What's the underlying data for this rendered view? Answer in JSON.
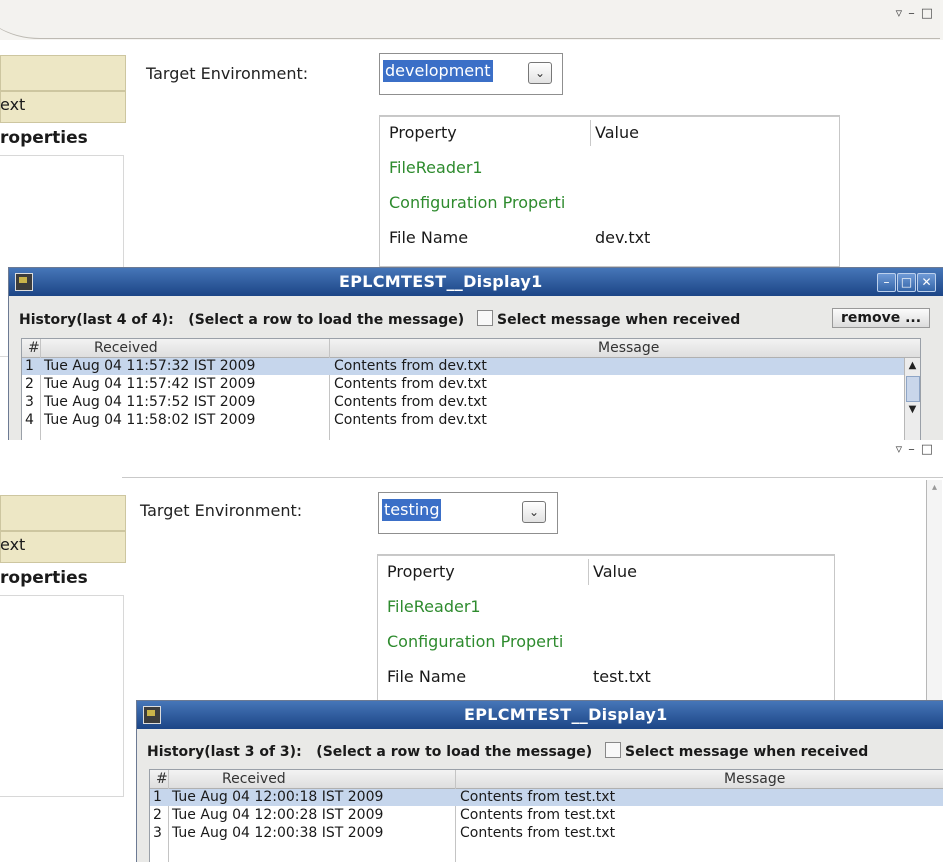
{
  "panels": [
    {
      "nav": {
        "item_text": "ext",
        "item_properties": "roperties"
      },
      "env_label": "Target Environment:",
      "env_value": "development",
      "prop_table": {
        "headers": [
          "Property",
          "Value"
        ],
        "rows": [
          {
            "property": "FileReader1",
            "value": ""
          },
          {
            "property": "Configuration Properti",
            "value": ""
          },
          {
            "property": "File Name",
            "value": "dev.txt"
          }
        ]
      },
      "window": {
        "title": "EPLCMTEST__Display1",
        "history_label": "History(last 4 of 4):",
        "hint": "(Select a row to load the message)",
        "checkbox_label": "Select message when received",
        "remove_label": "remove ...",
        "columns": [
          "#",
          "Received",
          "Message"
        ],
        "rows": [
          {
            "num": "1",
            "received": "Tue Aug 04 11:57:32 IST 2009",
            "message": "Contents from dev.txt",
            "selected": true
          },
          {
            "num": "2",
            "received": "Tue Aug 04 11:57:42 IST 2009",
            "message": "Contents from dev.txt",
            "selected": false
          },
          {
            "num": "3",
            "received": "Tue Aug 04 11:57:52 IST 2009",
            "message": "Contents from dev.txt",
            "selected": false
          },
          {
            "num": "4",
            "received": "Tue Aug 04 11:58:02 IST 2009",
            "message": "Contents from dev.txt",
            "selected": false
          }
        ]
      }
    },
    {
      "nav": {
        "item_text": "ext",
        "item_properties": "roperties"
      },
      "env_label": "Target Environment:",
      "env_value": "testing",
      "prop_table": {
        "headers": [
          "Property",
          "Value"
        ],
        "rows": [
          {
            "property": "FileReader1",
            "value": ""
          },
          {
            "property": "Configuration Properti",
            "value": ""
          },
          {
            "property": "File Name",
            "value": "test.txt"
          }
        ]
      },
      "window": {
        "title": "EPLCMTEST__Display1",
        "history_label": "History(last 3 of 3):",
        "hint": "(Select a row to load the message)",
        "checkbox_label": "Select message when received",
        "columns": [
          "#",
          "Received",
          "Message"
        ],
        "rows": [
          {
            "num": "1",
            "received": "Tue Aug 04 12:00:18 IST 2009",
            "message": "Contents from test.txt",
            "selected": true
          },
          {
            "num": "2",
            "received": "Tue Aug 04 12:00:28 IST 2009",
            "message": "Contents from test.txt",
            "selected": false
          },
          {
            "num": "3",
            "received": "Tue Aug 04 12:00:38 IST 2009",
            "message": "Contents from test.txt",
            "selected": false
          }
        ]
      }
    }
  ],
  "icons": {
    "minimize": "minimize-icon",
    "maximize": "maximize-icon",
    "close": "close-icon",
    "view_menu": "view-menu-icon",
    "dropdown": "chevron-down-icon"
  },
  "colors": {
    "selection": "#3b6fc7",
    "title_bar": "#1c4586",
    "property_green": "#2e8b2e",
    "nav_block": "#ede7c5"
  }
}
